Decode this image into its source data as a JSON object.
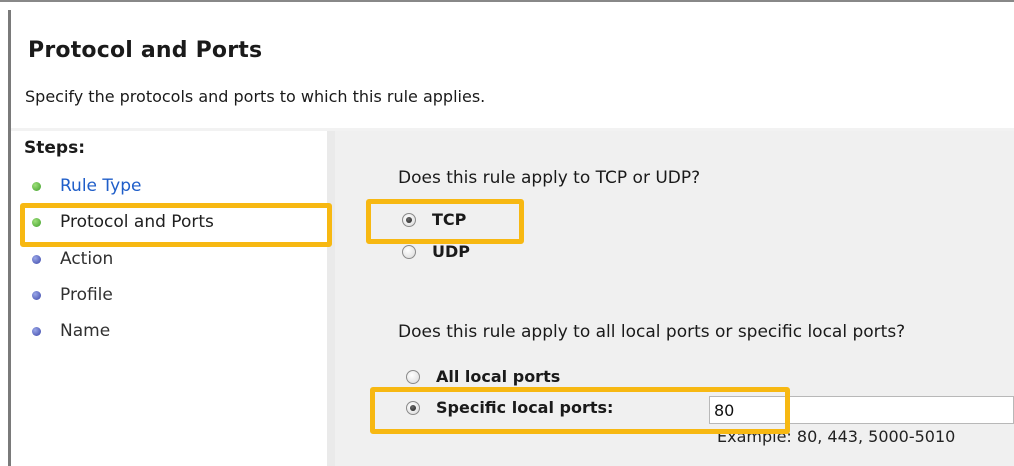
{
  "header": {
    "title": "Protocol and Ports",
    "subtitle": "Specify the protocols and ports to which this rule applies."
  },
  "sidebar": {
    "steps_title": "Steps:",
    "items": [
      {
        "label": "Rule Type",
        "state": "completed"
      },
      {
        "label": "Protocol and Ports",
        "state": "current"
      },
      {
        "label": "Action",
        "state": "pending"
      },
      {
        "label": "Profile",
        "state": "pending"
      },
      {
        "label": "Name",
        "state": "pending"
      }
    ]
  },
  "main": {
    "protocol_question": "Does this rule apply to TCP or UDP?",
    "protocol_options": [
      {
        "label": "TCP",
        "selected": true
      },
      {
        "label": "UDP",
        "selected": false
      }
    ],
    "ports_question": "Does this rule apply to all local ports or specific local ports?",
    "ports_options": [
      {
        "label": "All local ports",
        "selected": false
      },
      {
        "label": "Specific local ports:",
        "selected": true
      }
    ],
    "ports_value": "80",
    "ports_example": "Example: 80, 443, 5000-5010"
  },
  "colors": {
    "highlight": "#f7b812",
    "link": "#1f5ec9",
    "panel_bg": "#f0f0f0",
    "completed_dot": "#3f9e2a",
    "pending_dot": "#3b46a8"
  }
}
